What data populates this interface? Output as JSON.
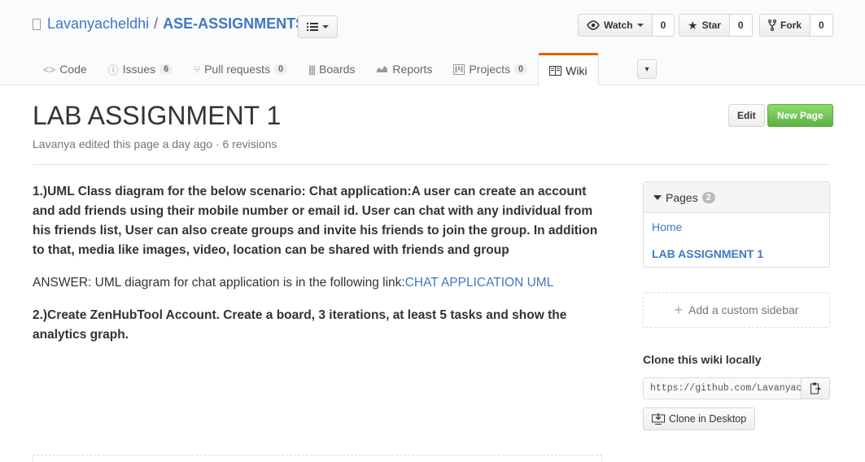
{
  "repo": {
    "owner": "Lavanyacheldhi",
    "separator": "/",
    "name": "ASE-ASSIGNMENTS"
  },
  "actions": {
    "watch_label": "Watch",
    "watch_count": "0",
    "star_label": "Star",
    "star_count": "0",
    "fork_label": "Fork",
    "fork_count": "0"
  },
  "tabs": [
    {
      "label": "Code",
      "icon": "code-icon"
    },
    {
      "label": "Issues",
      "icon": "issue-icon",
      "count": "6"
    },
    {
      "label": "Pull requests",
      "icon": "pull-request-icon",
      "count": "0"
    },
    {
      "label": "Boards",
      "icon": "boards-icon"
    },
    {
      "label": "Reports",
      "icon": "graph-icon"
    },
    {
      "label": "Projects",
      "icon": "project-icon",
      "count": "0"
    },
    {
      "label": "Wiki",
      "icon": "book-icon",
      "selected": true
    }
  ],
  "wiki": {
    "title": "LAB ASSIGNMENT 1",
    "meta": "Lavanya edited this page a day ago · 6 revisions",
    "edit_label": "Edit",
    "new_page_label": "New Page",
    "paragraph1": "1.)UML Class diagram for the below scenario: Chat application:A user can create an account and add friends using their mobile number or email id. User can chat with any individual from his friends list, User can also create groups and invite his friends to join the group. In addition to that, media like images, video, location can be shared with friends and group",
    "answer_text": "ANSWER: UML diagram for chat application is in the following link:",
    "answer_link": "CHAT APPLICATION UML",
    "paragraph2": "2.)Create ZenHubTool Account. Create a board, 3 iterations, at least 5 tasks and show the analytics graph."
  },
  "sidebar": {
    "pages_label": "Pages",
    "pages_count": "2",
    "pages": [
      "Home",
      "LAB ASSIGNMENT 1"
    ],
    "custom_sidebar_label": "Add a custom sidebar",
    "clone_label": "Clone this wiki locally",
    "clone_url": "https://github.com/Lavanyacheldhi/ASE-ASSIGNMENTS.wiki.git",
    "clone_desktop_label": "Clone in Desktop"
  },
  "colors": {
    "link": "#4078c0",
    "selected_tab_accent": "#e36209",
    "new_page_green": "#60b044"
  }
}
